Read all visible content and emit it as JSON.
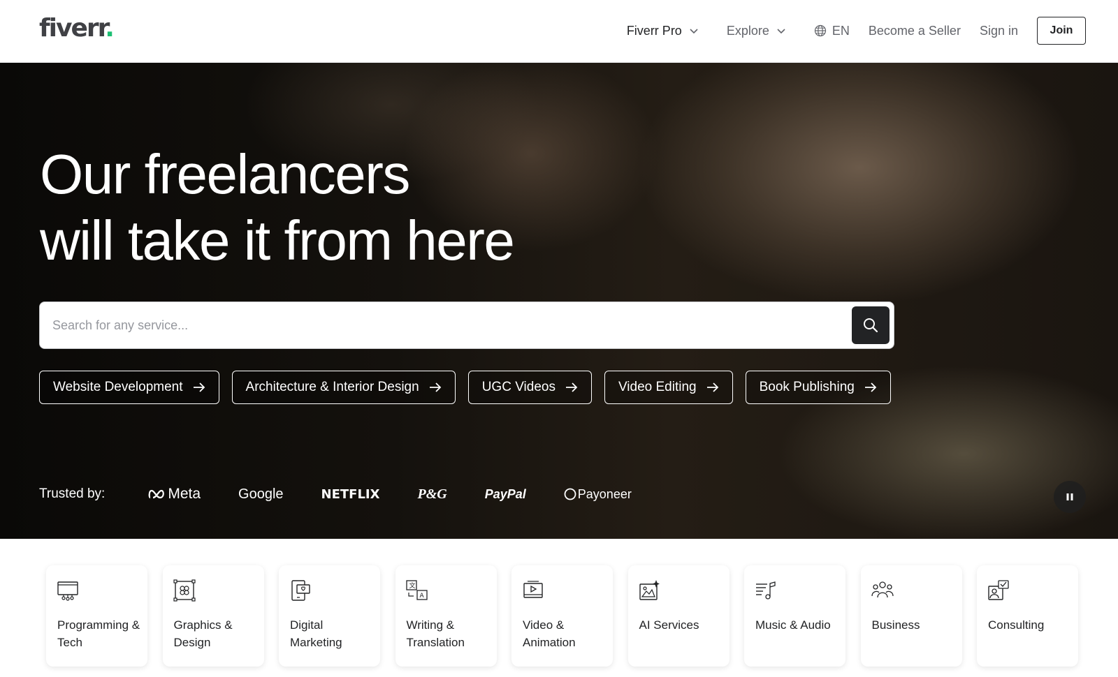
{
  "header": {
    "logo_text": "fiverr",
    "logo_dot": ".",
    "logo_dot_color": "#1dbf73",
    "nav": {
      "fiverr_pro": "Fiverr Pro",
      "explore": "Explore",
      "language": "EN",
      "become_seller": "Become a Seller",
      "sign_in": "Sign in",
      "join": "Join"
    }
  },
  "hero": {
    "title_line1": "Our freelancers",
    "title_line2": "will take it from here",
    "search": {
      "placeholder": "Search for any service..."
    },
    "chips": [
      {
        "label": "Website Development"
      },
      {
        "label": "Architecture & Interior Design"
      },
      {
        "label": "UGC Videos"
      },
      {
        "label": "Video Editing"
      },
      {
        "label": "Book Publishing"
      }
    ],
    "trusted_label": "Trusted by:",
    "brands": [
      "Meta",
      "Google",
      "NETFLIX",
      "P&G",
      "PayPal",
      "Payoneer"
    ]
  },
  "categories": [
    {
      "label": "Programming & Tech",
      "icon": "programming-icon"
    },
    {
      "label": "Graphics & Design",
      "icon": "graphics-icon"
    },
    {
      "label": "Digital Marketing",
      "icon": "marketing-icon"
    },
    {
      "label": "Writing & Translation",
      "icon": "translation-icon"
    },
    {
      "label": "Video & Animation",
      "icon": "video-icon"
    },
    {
      "label": "AI Services",
      "icon": "ai-icon"
    },
    {
      "label": "Music & Audio",
      "icon": "music-icon"
    },
    {
      "label": "Business",
      "icon": "business-icon"
    },
    {
      "label": "Consulting",
      "icon": "consulting-icon"
    }
  ]
}
